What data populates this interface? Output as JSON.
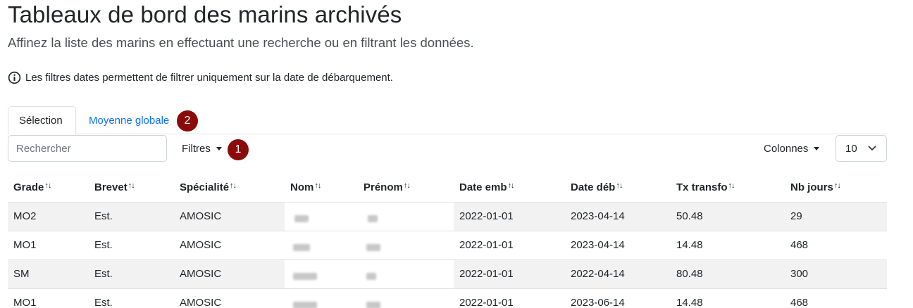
{
  "header": {
    "title": "Tableaux de bord des marins archivés",
    "subtitle": "Affinez la liste des marins en effectuant une recherche ou en filtrant les données.",
    "info": "Les filtres dates permettent de filtrer uniquement sur la date de débarquement."
  },
  "tabs": [
    {
      "label": "Sélection",
      "active": true
    },
    {
      "label": "Moyenne globale",
      "active": false
    }
  ],
  "badges": {
    "tab": "2",
    "filter": "1"
  },
  "toolbar": {
    "search_placeholder": "Rechercher",
    "filters_label": "Filtres",
    "columns_label": "Colonnes",
    "page_size": "10"
  },
  "table": {
    "columns": [
      "Grade",
      "Brevet",
      "Spécialité",
      "Nom",
      "Prénom",
      "Date emb",
      "Date déb",
      "Tx transfo",
      "Nb jours"
    ],
    "sort_glyph": "↑↓",
    "rows": [
      {
        "grade": "MO2",
        "brevet": "Est.",
        "specialite": "AMOSIC",
        "date_emb": "2022-01-01",
        "date_deb": "2023-04-14",
        "tx": "50.48",
        "jours": "29"
      },
      {
        "grade": "MO1",
        "brevet": "Est.",
        "specialite": "AMOSIC",
        "date_emb": "2022-01-01",
        "date_deb": "2023-04-14",
        "tx": "14.48",
        "jours": "468"
      },
      {
        "grade": "SM",
        "brevet": "Est.",
        "specialite": "AMOSIC",
        "date_emb": "2022-01-01",
        "date_deb": "2022-04-14",
        "tx": "80.48",
        "jours": "300"
      },
      {
        "grade": "MO1",
        "brevet": "Est.",
        "specialite": "AMOSIC",
        "date_emb": "2022-01-01",
        "date_deb": "2023-06-14",
        "tx": "14.48",
        "jours": "468"
      }
    ]
  },
  "colors": {
    "accent": "#0d6efd",
    "badge": "#8b0a0a",
    "stripe": "#f2f2f2"
  }
}
